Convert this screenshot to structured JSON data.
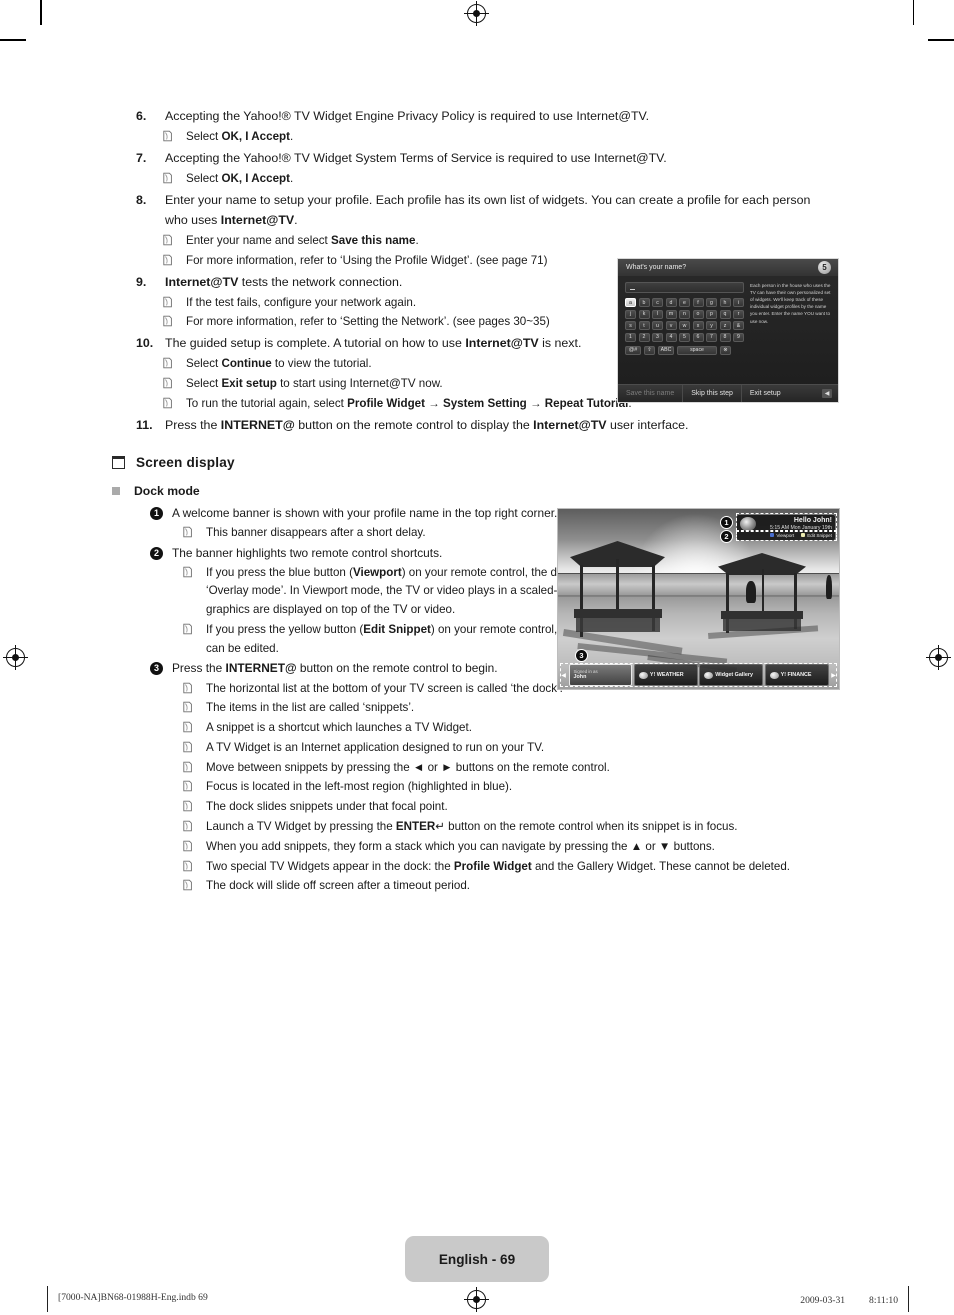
{
  "steps": [
    {
      "num": "6.",
      "parts": [
        {
          "t": "Accepting the Yahoo!® TV Widget Engine Privacy Policy is required to use Internet@TV."
        }
      ],
      "notes": [
        {
          "pre": "Select ",
          "bold": "OK, I Accept",
          "post": "."
        }
      ]
    },
    {
      "num": "7.",
      "parts": [
        {
          "t": "Accepting the Yahoo!® TV Widget System Terms of Service is required to use Internet@TV."
        }
      ],
      "notes": [
        {
          "pre": "Select ",
          "bold": "OK, I Accept",
          "post": "."
        }
      ]
    },
    {
      "num": "8.",
      "parts": [
        {
          "t": "Enter your name to setup your profile. Each profile has its own list of widgets. You can create a profile for each person who uses "
        },
        {
          "t": "Internet@TV",
          "bold": true
        },
        {
          "t": "."
        }
      ],
      "notes": [
        {
          "pre": "Enter your name and select ",
          "bold": "Save this name",
          "post": "."
        },
        {
          "pre": "For more information, refer to ‘Using the Profile Widget’. (see page 71)",
          "bold": "",
          "post": ""
        }
      ]
    },
    {
      "num": "9.",
      "parts": [
        {
          "t": "Internet@TV",
          "bold": true
        },
        {
          "t": " tests the network connection."
        }
      ],
      "notes": [
        {
          "pre": "If the test fails, configure your network again.",
          "bold": "",
          "post": ""
        },
        {
          "pre": "For more information, refer to ‘Setting the Network’. (see pages 30~35)",
          "bold": "",
          "post": ""
        }
      ]
    },
    {
      "num": "10.",
      "parts": [
        {
          "t": "The guided setup is complete. A tutorial on how to use "
        },
        {
          "t": "Internet@TV",
          "bold": true
        },
        {
          "t": " is next."
        }
      ],
      "notes": [
        {
          "pre": "Select ",
          "bold": "Continue",
          "post": " to view the tutorial."
        },
        {
          "pre": "Select ",
          "bold": "Exit setup",
          "post": " to start using Internet@TV now."
        },
        {
          "pre": "To run the tutorial again, select ",
          "bold": "Profile Widget → System Setting → Repeat Tutorial",
          "post": "."
        }
      ]
    },
    {
      "num": "11.",
      "parts": [
        {
          "t": "Press the "
        },
        {
          "t": "INTERNET@",
          "bold": true
        },
        {
          "t": " button on the remote control to display the "
        },
        {
          "t": "Internet@TV",
          "bold": true
        },
        {
          "t": " user interface."
        }
      ],
      "notes": []
    }
  ],
  "section": {
    "heading": "Screen display",
    "sub_heading": "Dock mode"
  },
  "dock_items": [
    {
      "num": "1",
      "parts": [
        {
          "t": "A welcome banner is shown with your profile name in the top right corner."
        }
      ],
      "narrow": true,
      "notes": [
        {
          "pre": "This banner disappears after a short delay.",
          "bold": "",
          "post": "",
          "narrow": true
        }
      ]
    },
    {
      "num": "2",
      "parts": [
        {
          "t": "The banner highlights two remote control shortcuts."
        }
      ],
      "narrow": true,
      "notes": [
        {
          "pre": "If you press the blue button (",
          "bold": "Viewport",
          "post": ") on your remote control, the display is toggled between ‘Viewport mode’ and ‘Overlay mode’. In Viewport mode, the TV or video plays in a scaled-down area with graphics outside. In overlay mode, the graphics are displayed on top of the TV or video.",
          "narrow": true
        },
        {
          "pre": "If you press the yellow button (",
          "bold": "Edit Snippet",
          "post": ") on your remote control, a help window is displayed and the snippet with focus can be edited.",
          "narrow": true
        }
      ]
    },
    {
      "num": "3",
      "parts": [
        {
          "t": "Press the "
        },
        {
          "t": "INTERNET@",
          "bold": true
        },
        {
          "t": " button on the remote control to begin."
        }
      ],
      "narrow": false,
      "notes": [
        {
          "pre": "The horizontal list at the bottom of your TV screen is called ‘the dock’.",
          "bold": "",
          "post": ""
        },
        {
          "pre": "The items in the list are called ‘snippets’.",
          "bold": "",
          "post": ""
        },
        {
          "pre": "A snippet is a shortcut which launches a TV Widget.",
          "bold": "",
          "post": ""
        },
        {
          "pre": "A TV Widget is an Internet application designed to run on your TV.",
          "bold": "",
          "post": ""
        },
        {
          "pre": "Move between snippets by pressing the ◄ or ► buttons on the remote control.",
          "bold": "",
          "post": ""
        },
        {
          "pre": "Focus is located in the left-most region (highlighted in blue).",
          "bold": "",
          "post": ""
        },
        {
          "pre": "The dock slides snippets under that focal point.",
          "bold": "",
          "post": ""
        },
        {
          "pre": "Launch a TV Widget by pressing the ",
          "bold": "ENTER",
          "post": "↵ button on the remote control when its snippet is in focus."
        },
        {
          "pre": "When you add snippets, they form a stack which you can navigate by pressing the ▲ or ▼ buttons.",
          "bold": "",
          "post": ""
        },
        {
          "pre": "Two special TV Widgets appear in the dock: the ",
          "bold": "Profile Widget",
          "post": " and the Gallery Widget. These cannot be deleted."
        },
        {
          "pre": "The dock will slide off screen after a timeout period.",
          "bold": "",
          "post": ""
        }
      ]
    }
  ],
  "tv_keyboard": {
    "title": "What's your name?",
    "step_badge": "5",
    "description": "Each person in the house who uses the TV can have their own personalized set of widgets. We'll keep track of these individual widget profiles by the name you enter. Enter the name YOU want to use now.",
    "input_value": "",
    "rows": [
      [
        "a",
        "b",
        "c",
        "d",
        "e",
        "f",
        "g",
        "h",
        "i"
      ],
      [
        "j",
        "k",
        "l",
        "m",
        "n",
        "o",
        "p",
        "q",
        "r"
      ],
      [
        "s",
        "t",
        "u",
        "v",
        "w",
        "x",
        "y",
        "z",
        "&"
      ],
      [
        "1",
        "2",
        "3",
        "4",
        "5",
        "6",
        "7",
        "8",
        "9"
      ]
    ],
    "selected_key": "a",
    "function_keys": [
      "@#",
      "⇧",
      "ABC",
      "space",
      "⊗"
    ],
    "space_label": "space",
    "buttons": [
      {
        "label": "Save this name",
        "dim": true
      },
      {
        "label": "Skip this step",
        "dim": false
      },
      {
        "label": "Exit setup",
        "dim": false
      }
    ],
    "back_arrow": "◀"
  },
  "tv_dock": {
    "banner": {
      "greeting": "Hello John!",
      "time": "5:15 AM Mon January 19th",
      "shortcuts": [
        {
          "label": "Viewport",
          "color": "#4a6fd0"
        },
        {
          "label": "Edit Snippet",
          "color": "#e0e0a0"
        }
      ]
    },
    "markers": [
      "1",
      "2",
      "3"
    ],
    "snippets": [
      {
        "sub": "Signed in as",
        "label": "John",
        "icon": "profile-icon",
        "focus": true
      },
      {
        "sub": "",
        "label": "Y! WEATHER",
        "icon": "weather-icon",
        "focus": false
      },
      {
        "sub": "",
        "label": "Widget Gallery",
        "icon": "gallery-icon",
        "focus": false
      },
      {
        "sub": "",
        "label": "Y! FINANCE",
        "icon": "finance-icon",
        "focus": false
      }
    ],
    "left_arrow": "◀",
    "right_arrow": "▶"
  },
  "footer": {
    "page_label": "English - 69",
    "file_info": "[7000-NA]BN68-01988H-Eng.indb   69",
    "timestamp": "2009-03-31   　　 8:11:10"
  }
}
